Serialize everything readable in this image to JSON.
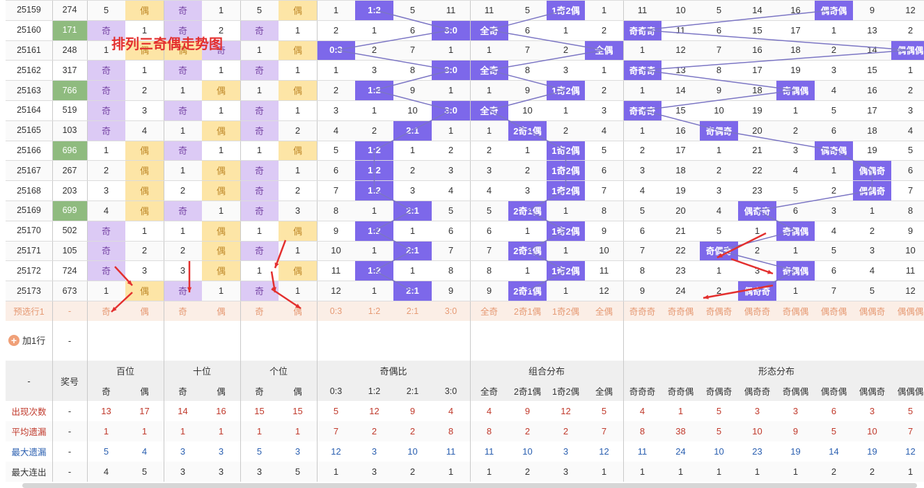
{
  "title_overlay": "排列三奇偶走势图",
  "colors": {
    "purple": "#7d68ea",
    "light_purple": "#dccaf5",
    "light_yellow": "#fde5a6",
    "green_award": "#8fbb7f",
    "forecast_bg": "#fbeee6",
    "forecast_text": "#e69a74",
    "header_bg": "#efefef",
    "blue_text": "#2a5fb0",
    "red_text": "#c0392b",
    "line": "#7b75c4"
  },
  "rows": [
    {
      "issue": "25159",
      "award": "274",
      "b": "5",
      "s": "偶",
      "g": "奇",
      "j": "1",
      "k": "5",
      "l": "偶",
      "ratio": [
        "1",
        "1:2",
        "5",
        "11"
      ],
      "combo": [
        "11",
        "5",
        "1奇2偶",
        "1"
      ],
      "shape": [
        "11",
        "10",
        "5",
        "14",
        "16",
        "偶奇偶",
        "9",
        "12",
        "1"
      ]
    },
    {
      "issue": "25160",
      "award": "171",
      "b": "奇",
      "s": "1",
      "g": "奇",
      "j": "2",
      "k": "奇",
      "l": "1",
      "ratio": [
        "2",
        "1",
        "6",
        "3:0"
      ],
      "combo": [
        "全奇",
        "6",
        "1",
        "2"
      ],
      "shape": [
        "奇奇奇",
        "11",
        "6",
        "15",
        "17",
        "1",
        "13",
        "2"
      ]
    },
    {
      "issue": "25161",
      "award": "248",
      "b": "1",
      "s": "偶",
      "g": "偶",
      "j": "奇",
      "k": "1",
      "l": "偶",
      "ratio": [
        "0:3",
        "2",
        "7",
        "1"
      ],
      "combo": [
        "1",
        "7",
        "2",
        "全偶"
      ],
      "shape": [
        "1",
        "12",
        "7",
        "16",
        "18",
        "2",
        "14",
        "偶偶偶"
      ]
    },
    {
      "issue": "25162",
      "award": "317",
      "b": "奇",
      "s": "1",
      "g": "奇",
      "j": "1",
      "k": "奇",
      "l": "1",
      "ratio": [
        "1",
        "3",
        "8",
        "3:0"
      ],
      "combo": [
        "全奇",
        "8",
        "3",
        "1"
      ],
      "shape": [
        "奇奇奇",
        "13",
        "8",
        "17",
        "19",
        "3",
        "15",
        "1"
      ]
    },
    {
      "issue": "25163",
      "award": "766",
      "b": "奇",
      "s": "2",
      "g": "1",
      "j": "偶",
      "k": "1",
      "l": "偶",
      "ratio": [
        "2",
        "1:2",
        "9",
        "1"
      ],
      "combo": [
        "1",
        "9",
        "1奇2偶",
        "2"
      ],
      "shape": [
        "1",
        "14",
        "9",
        "18",
        "奇偶偶",
        "4",
        "16",
        "2"
      ]
    },
    {
      "issue": "25164",
      "award": "519",
      "b": "奇",
      "s": "3",
      "g": "奇",
      "j": "1",
      "k": "奇",
      "l": "1",
      "ratio": [
        "3",
        "1",
        "10",
        "3:0"
      ],
      "combo": [
        "全奇",
        "10",
        "1",
        "3"
      ],
      "shape": [
        "奇奇奇",
        "15",
        "10",
        "19",
        "1",
        "5",
        "17",
        "3"
      ]
    },
    {
      "issue": "25165",
      "award": "103",
      "b": "奇",
      "s": "4",
      "g": "1",
      "j": "偶",
      "k": "奇",
      "l": "2",
      "ratio": [
        "4",
        "2",
        "2:1",
        "1"
      ],
      "combo": [
        "1",
        "2奇1偶",
        "2",
        "4"
      ],
      "shape": [
        "1",
        "16",
        "奇偶奇",
        "20",
        "2",
        "6",
        "18",
        "4"
      ]
    },
    {
      "issue": "25166",
      "award": "696",
      "b": "1",
      "s": "偶",
      "g": "奇",
      "j": "1",
      "k": "1",
      "l": "偶",
      "ratio": [
        "5",
        "1:2",
        "1",
        "2"
      ],
      "combo": [
        "2",
        "1",
        "1奇2偶",
        "5"
      ],
      "shape": [
        "2",
        "17",
        "1",
        "21",
        "3",
        "偶奇偶",
        "19",
        "5"
      ]
    },
    {
      "issue": "25167",
      "award": "267",
      "b": "2",
      "s": "偶",
      "g": "1",
      "j": "偶",
      "k": "奇",
      "l": "1",
      "ratio": [
        "6",
        "1:2",
        "2",
        "3"
      ],
      "combo": [
        "3",
        "2",
        "1奇2偶",
        "6"
      ],
      "shape": [
        "3",
        "18",
        "2",
        "22",
        "4",
        "1",
        "偶偶奇",
        "6"
      ]
    },
    {
      "issue": "25168",
      "award": "203",
      "b": "3",
      "s": "偶",
      "g": "2",
      "j": "偶",
      "k": "奇",
      "l": "2",
      "ratio": [
        "7",
        "1:2",
        "3",
        "4"
      ],
      "combo": [
        "4",
        "3",
        "1奇2偶",
        "7"
      ],
      "shape": [
        "4",
        "19",
        "3",
        "23",
        "5",
        "2",
        "偶偶奇",
        "7"
      ]
    },
    {
      "issue": "25169",
      "award": "699",
      "b": "4",
      "s": "偶",
      "g": "奇",
      "j": "1",
      "k": "奇",
      "l": "3",
      "ratio": [
        "8",
        "1",
        "2:1",
        "5"
      ],
      "combo": [
        "5",
        "2奇1偶",
        "1",
        "8"
      ],
      "shape": [
        "5",
        "20",
        "4",
        "偶奇奇",
        "6",
        "3",
        "1",
        "8"
      ]
    },
    {
      "issue": "25170",
      "award": "502",
      "b": "奇",
      "s": "1",
      "g": "1",
      "j": "偶",
      "k": "1",
      "l": "偶",
      "ratio": [
        "9",
        "1:2",
        "1",
        "6"
      ],
      "combo": [
        "6",
        "1",
        "1奇2偶",
        "9"
      ],
      "shape": [
        "6",
        "21",
        "5",
        "1",
        "奇偶偶",
        "4",
        "2",
        "9"
      ]
    },
    {
      "issue": "25171",
      "award": "105",
      "b": "奇",
      "s": "2",
      "g": "2",
      "j": "偶",
      "k": "奇",
      "l": "1",
      "ratio": [
        "10",
        "1",
        "2:1",
        "7"
      ],
      "combo": [
        "7",
        "2奇1偶",
        "1",
        "10"
      ],
      "shape": [
        "7",
        "22",
        "奇偶奇",
        "2",
        "1",
        "5",
        "3",
        "10"
      ]
    },
    {
      "issue": "25172",
      "award": "724",
      "b": "奇",
      "s": "3",
      "g": "3",
      "j": "偶",
      "k": "1",
      "l": "偶",
      "ratio": [
        "11",
        "1:2",
        "1",
        "8"
      ],
      "combo": [
        "8",
        "1",
        "1奇2偶",
        "11"
      ],
      "shape": [
        "8",
        "23",
        "1",
        "3",
        "奇偶偶",
        "6",
        "4",
        "11"
      ]
    },
    {
      "issue": "25173",
      "award": "673",
      "b": "1",
      "s": "偶",
      "g": "奇",
      "j": "1",
      "k": "奇",
      "l": "1",
      "ratio": [
        "12",
        "1",
        "2:1",
        "9"
      ],
      "combo": [
        "9",
        "2奇1偶",
        "1",
        "12"
      ],
      "shape": [
        "9",
        "24",
        "2",
        "偶奇奇",
        "1",
        "7",
        "5",
        "12"
      ]
    }
  ],
  "forecast": {
    "label": "预选行1",
    "dash": "-",
    "cells": [
      "奇",
      "偶",
      "奇",
      "偶",
      "奇",
      "偶",
      "0:3",
      "1:2",
      "2:1",
      "3:0",
      "全奇",
      "2奇1偶",
      "1奇2偶",
      "全偶",
      "奇奇奇",
      "奇奇偶",
      "奇偶奇",
      "偶奇奇",
      "奇偶偶",
      "偶奇偶",
      "偶偶奇",
      "偶偶偶"
    ]
  },
  "add_row": {
    "label": "加1行",
    "dash": "-"
  },
  "header": {
    "dash": "-",
    "award": "奖号",
    "groups": [
      "百位",
      "十位",
      "个位",
      "奇偶比",
      "组合分布",
      "形态分布"
    ],
    "subs": [
      "奇",
      "偶",
      "奇",
      "偶",
      "奇",
      "偶",
      "0:3",
      "1:2",
      "2:1",
      "3:0",
      "全奇",
      "2奇1偶",
      "1奇2偶",
      "全偶",
      "奇奇奇",
      "奇奇偶",
      "奇偶奇",
      "偶奇奇",
      "奇偶偶",
      "偶奇偶",
      "偶偶奇",
      "偶偶偶"
    ]
  },
  "stats": [
    {
      "label": "出现次数",
      "dash": "-",
      "values": [
        "13",
        "17",
        "14",
        "16",
        "15",
        "15",
        "5",
        "12",
        "9",
        "4",
        "4",
        "9",
        "12",
        "5",
        "4",
        "1",
        "5",
        "3",
        "3",
        "6",
        "3",
        "5"
      ]
    },
    {
      "label": "平均遗漏",
      "dash": "-",
      "values": [
        "1",
        "1",
        "1",
        "1",
        "1",
        "1",
        "7",
        "2",
        "2",
        "8",
        "8",
        "2",
        "2",
        "7",
        "8",
        "38",
        "5",
        "10",
        "9",
        "5",
        "10",
        "7"
      ]
    },
    {
      "label": "最大遗漏",
      "dash": "-",
      "values": [
        "5",
        "4",
        "3",
        "3",
        "5",
        "3",
        "12",
        "3",
        "10",
        "11",
        "11",
        "10",
        "3",
        "12",
        "11",
        "24",
        "10",
        "23",
        "19",
        "14",
        "19",
        "12"
      ]
    },
    {
      "label": "最大连出",
      "dash": "-",
      "values": [
        "4",
        "5",
        "3",
        "3",
        "3",
        "5",
        "1",
        "3",
        "2",
        "1",
        "1",
        "2",
        "3",
        "1",
        "1",
        "1",
        "1",
        "1",
        "1",
        "2",
        "2",
        "1"
      ]
    }
  ]
}
